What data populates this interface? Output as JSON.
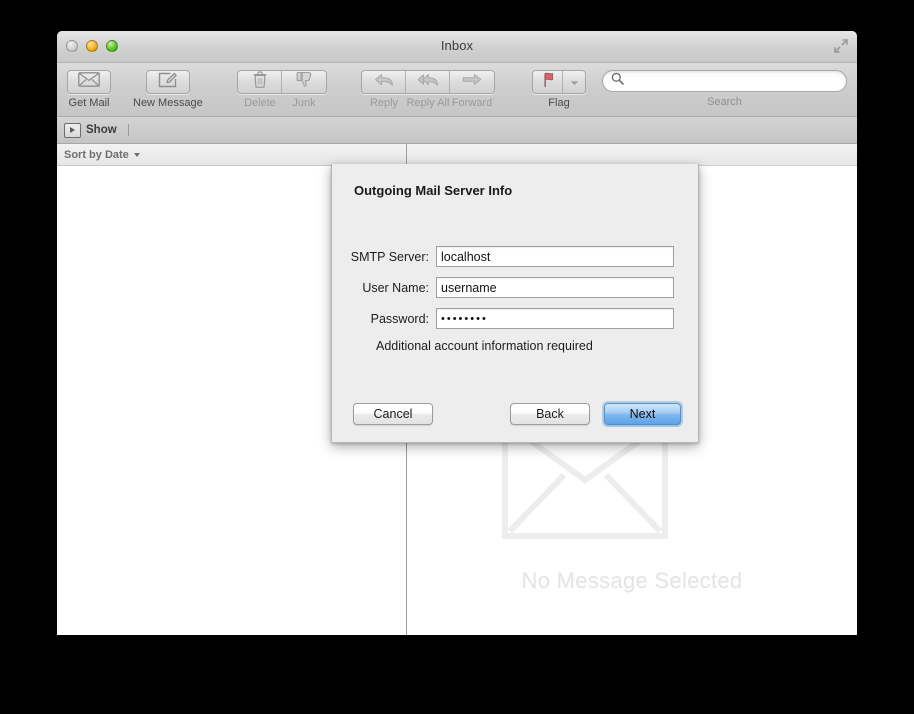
{
  "window": {
    "title": "Inbox",
    "controls": {
      "close": "close-button",
      "minimize": "minimize-button",
      "zoom": "zoom-button",
      "fullscreen": "fullscreen-button"
    }
  },
  "toolbar": {
    "get_mail": {
      "label": "Get Mail",
      "icon": "envelope-icon",
      "enabled": true
    },
    "new_message": {
      "label": "New Message",
      "icon": "compose-icon",
      "enabled": true
    },
    "delete": {
      "label": "Delete",
      "icon": "trash-icon",
      "enabled": false
    },
    "junk": {
      "label": "Junk",
      "icon": "thumbs-down-icon",
      "enabled": false
    },
    "reply": {
      "label": "Reply",
      "icon": "reply-arrow-icon",
      "enabled": false
    },
    "reply_all": {
      "label": "Reply All",
      "icon": "reply-all-arrow-icon",
      "enabled": false
    },
    "forward": {
      "label": "Forward",
      "icon": "forward-arrow-icon",
      "enabled": false
    },
    "flag": {
      "label": "Flag",
      "icon": "flag-icon",
      "enabled": true
    },
    "search": {
      "label": "Search",
      "placeholder": "",
      "value": "",
      "icon": "search-icon"
    }
  },
  "showbar": {
    "show_label": "Show",
    "show_icon": "disclosure-triangle-icon"
  },
  "list_pane": {
    "sort_label": "Sort by Date",
    "sort_caret": "chevron-down-icon",
    "messages": []
  },
  "message_pane": {
    "empty_text": "No Message Selected",
    "watermark_icon": "envelope-watermark-icon"
  },
  "dialog": {
    "title": "Outgoing Mail Server Info",
    "fields": [
      {
        "label": "SMTP Server:",
        "value": "localhost",
        "placeholder": "",
        "type": "text",
        "name": "smtp-server-field"
      },
      {
        "label": "User Name:",
        "value": "username",
        "placeholder": "",
        "type": "text",
        "name": "user-name-field"
      },
      {
        "label": "Password:",
        "value": "••••••••",
        "placeholder": "",
        "type": "password",
        "name": "password-field"
      }
    ],
    "hint": "Additional account information required",
    "buttons": {
      "cancel": "Cancel",
      "back": "Back",
      "next": "Next"
    },
    "default_button": "Next"
  },
  "colors": {
    "accent_blue": "#5da3e9",
    "toolbar_gray": "#cdcdcd",
    "dialog_bg": "#ededed",
    "watermark_gray": "#e4e4e4",
    "flag_red": "#d4666e"
  }
}
